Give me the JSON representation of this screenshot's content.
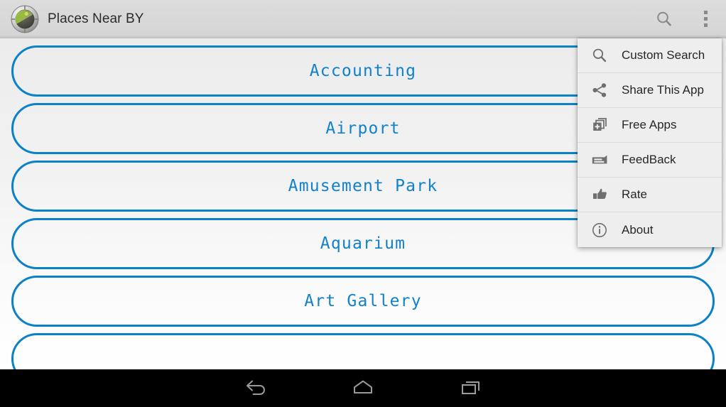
{
  "action_bar": {
    "logo_icon": "radar-app-icon",
    "title": "Places Near BY",
    "search_icon": "search-icon",
    "overflow_icon": "overflow-menu-icon",
    "background_color": "#d6d6d6",
    "title_color": "#2b2b2b"
  },
  "list": {
    "accent_color": "#0b81c7",
    "text_color": "#1181c9",
    "items": [
      {
        "label": "Accounting"
      },
      {
        "label": "Airport"
      },
      {
        "label": "Amusement Park"
      },
      {
        "label": "Aquarium"
      },
      {
        "label": "Art Gallery"
      },
      {
        "label": ""
      }
    ]
  },
  "overflow_menu": {
    "visible": true,
    "background_color": "#eeeeee",
    "items": [
      {
        "label": "Custom Search",
        "icon": "search-icon"
      },
      {
        "label": "Share This App",
        "icon": "share-icon"
      },
      {
        "label": "Free Apps",
        "icon": "add-apps-icon"
      },
      {
        "label": "FeedBack",
        "icon": "feedback-card-icon"
      },
      {
        "label": "Rate",
        "icon": "thumbs-up-icon"
      },
      {
        "label": "About",
        "icon": "info-icon"
      }
    ]
  },
  "nav_bar": {
    "background_color": "#000000",
    "buttons": [
      {
        "name": "back",
        "icon": "back-arrow-icon"
      },
      {
        "name": "home",
        "icon": "home-icon"
      },
      {
        "name": "recents",
        "icon": "recents-icon"
      }
    ]
  }
}
